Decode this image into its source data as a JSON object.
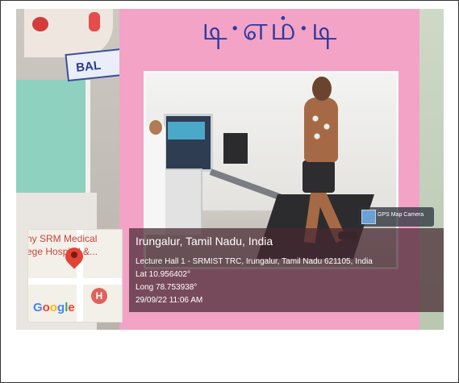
{
  "scene": {
    "tamil_title": "டி·எம்·டி",
    "side_card_text": "BAL"
  },
  "gps_overlay": {
    "badge_label": "GPS Map Camera",
    "location_title": "Irungalur, Tamil Nadu, India",
    "address": "Lecture Hall 1 - SRMIST TRC, Irungalur, Tamil Nadu 621105, India",
    "lat": "Lat 10.956402°",
    "long": "Long 78.753938°",
    "datetime": "29/09/22 11:06 AM"
  },
  "map": {
    "label_line1": "ny SRM Medical",
    "label_line2": "ege Hospital &...",
    "hospital_marker": "H",
    "logo": "Google",
    "logo_colors": [
      "#4285F4",
      "#EA4335",
      "#FBBC05",
      "#4285F4",
      "#34A853",
      "#EA4335"
    ]
  }
}
